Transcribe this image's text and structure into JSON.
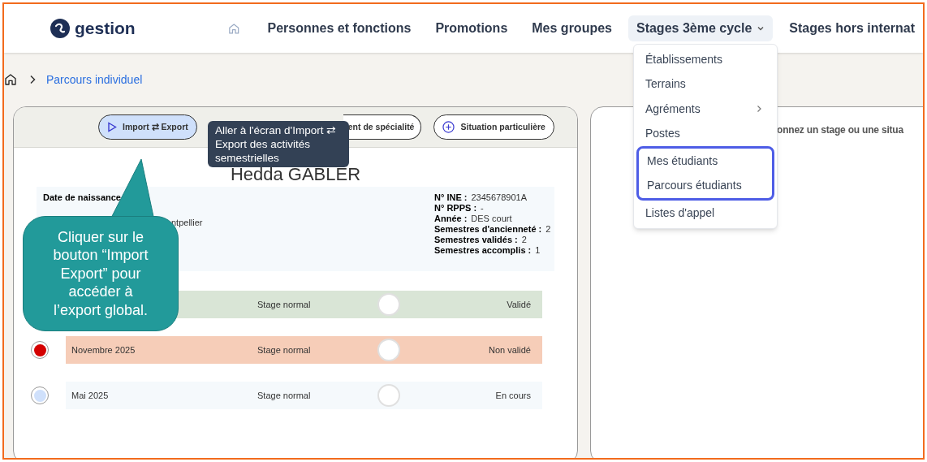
{
  "header": {
    "logo_text": "gestion",
    "nav": [
      {
        "label": "Personnes et fonctions",
        "expanded": false
      },
      {
        "label": "Promotions",
        "expanded": false
      },
      {
        "label": "Mes groupes",
        "expanded": false
      },
      {
        "label": "Stages 3ème cycle",
        "expanded": true,
        "caret": true
      },
      {
        "label": "Stages hors internat",
        "expanded": false
      }
    ]
  },
  "dropdown": {
    "items": [
      {
        "label": "Établissements",
        "submenu": false,
        "highlighted": false
      },
      {
        "label": "Terrains",
        "submenu": false,
        "highlighted": false
      },
      {
        "label": "Agréments",
        "submenu": true,
        "highlighted": false
      },
      {
        "label": "Postes",
        "submenu": false,
        "highlighted": false
      },
      {
        "label": "Mes étudiants",
        "submenu": false,
        "highlighted": true
      },
      {
        "label": "Parcours étudiants",
        "submenu": false,
        "highlighted": true
      },
      {
        "label": "Listes d'appel",
        "submenu": false,
        "highlighted": false
      }
    ]
  },
  "breadcrumb": {
    "current": "Parcours individuel"
  },
  "toolbar": [
    {
      "label": "Import ⇄ Export",
      "kind": "play",
      "selected": true
    },
    {
      "label": "ent de spécialité",
      "kind": "partial",
      "selected": false
    },
    {
      "label": "Situation particulière",
      "kind": "plus",
      "selected": false
    }
  ],
  "tooltip": "Aller à l'écran d'Import ⇄ Export des activités semestrielles",
  "student": {
    "name": "Hedda GABLER",
    "left": [
      {
        "text": "Date de naissance"
      },
      {
        "text": "ntpellier"
      }
    ],
    "fields": [
      {
        "label": "N° INE :",
        "value": "2345678901A"
      },
      {
        "label": "N° RPPS :",
        "value": "-"
      },
      {
        "label": "Année :",
        "value": "DES court"
      },
      {
        "label": "Semestres d'ancienneté :",
        "value": "2"
      },
      {
        "label": "Semestres validés :",
        "value": "2"
      },
      {
        "label": "Semestres accomplis :",
        "value": "1"
      }
    ]
  },
  "semesters": [
    {
      "type": "Stage normal",
      "status": "Validé",
      "color": "#d9e5d6"
    },
    {
      "month": "Novembre 2025",
      "type": "Stage normal",
      "status": "Non validé",
      "color": "#f6cdb8",
      "dot": {
        "color": "#d40000"
      }
    },
    {
      "month": "Mai 2025",
      "type": "Stage normal",
      "status": "En cours",
      "color": "#f5f9fc",
      "dot": {
        "color": "#cfe0fb"
      }
    }
  ],
  "right_panel": {
    "hint": "onnez un stage ou une situa"
  },
  "callout": "Cliquer sur le bouton “Import Export” pour accéder à l’export global."
}
